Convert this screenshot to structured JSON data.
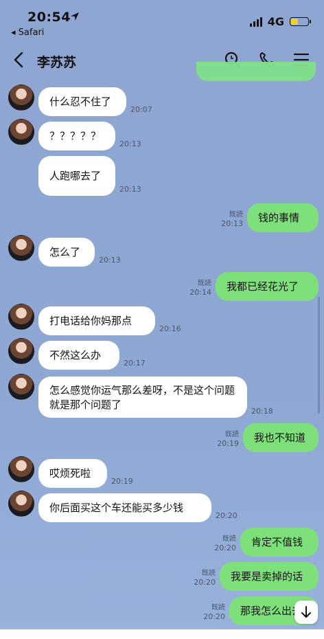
{
  "status_bar": {
    "time": "20:54",
    "back_app": "◂ Safari",
    "network": "4G",
    "battery_level": 0.4
  },
  "header": {
    "title": "李苏苏"
  },
  "read_label": "既読",
  "messages": [
    {
      "side": "in",
      "text": "什么忍不住了",
      "time": "20:07"
    },
    {
      "side": "in",
      "text": "？？？？？",
      "time": "20:13"
    },
    {
      "side": "in",
      "text": "人跑哪去了",
      "time": "20:13"
    },
    {
      "side": "out",
      "text": "钱的事情",
      "time": "20:13"
    },
    {
      "side": "in",
      "text": "怎么了",
      "time": "20:13"
    },
    {
      "side": "out",
      "text": "我都已经花光了",
      "time": "20:14"
    },
    {
      "side": "in",
      "text": "打电话给你妈那点",
      "time": "20:16"
    },
    {
      "side": "in",
      "text": "不然这么办",
      "time": "20:17"
    },
    {
      "side": "in",
      "text": "怎么感觉你运气那么差呀，不是这个问题就是那个问题了",
      "time": "20:18"
    },
    {
      "side": "out",
      "text": "我也不知道",
      "time": "20:19"
    },
    {
      "side": "in",
      "text": "哎烦死啦",
      "time": "20:19"
    },
    {
      "side": "in",
      "text": "你后面买这个车还能买多少钱",
      "time": "20:20"
    },
    {
      "side": "out",
      "text": "肯定不值钱",
      "time": "20:20"
    },
    {
      "side": "out",
      "text": "我要是卖掉的话",
      "time": "20:20"
    },
    {
      "side": "out",
      "text": "那我怎么出去",
      "time": "20:20"
    }
  ],
  "colors": {
    "background": "#8fa6d3",
    "incoming_bubble": "#ffffff",
    "outgoing_bubble": "#7ee07a"
  },
  "icons": [
    "location-arrow-icon",
    "back-chevron-icon",
    "search-icon",
    "phone-icon",
    "menu-icon",
    "scroll-down-icon"
  ]
}
